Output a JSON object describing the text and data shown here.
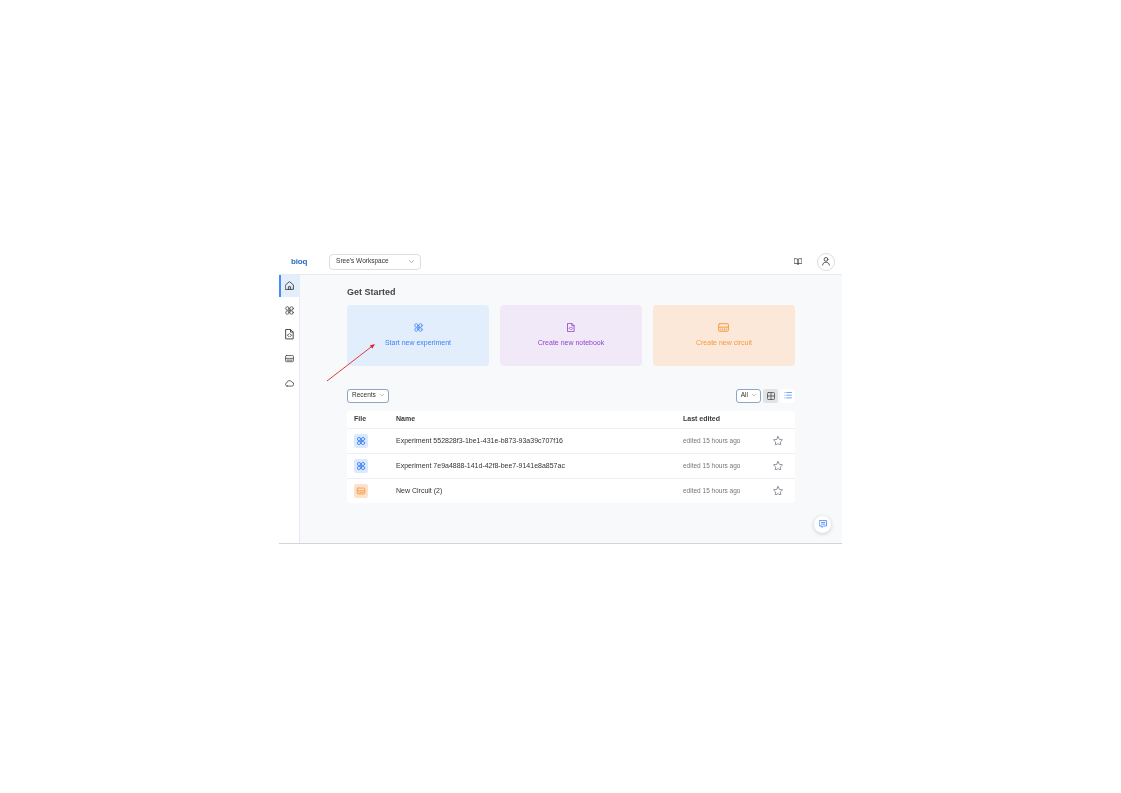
{
  "header": {
    "logo": "bioq",
    "workspace": "Sree's Workspace"
  },
  "sidebar": {
    "items": [
      {
        "kind": "home",
        "selected": true
      },
      {
        "kind": "experiment",
        "selected": false
      },
      {
        "kind": "notebook",
        "selected": false
      },
      {
        "kind": "circuit",
        "selected": false
      },
      {
        "kind": "cloud",
        "selected": false
      }
    ]
  },
  "heading": "Get Started",
  "quick_actions": [
    {
      "kind": "experiment",
      "label": "Start new experiment"
    },
    {
      "kind": "notebook",
      "label": "Create new notebook"
    },
    {
      "kind": "circuit",
      "label": "Create new circuit"
    }
  ],
  "filter": {
    "value": "Recents"
  },
  "type_filter": {
    "value": "All"
  },
  "view_toggle": [
    {
      "kind": "grid",
      "selected": true
    },
    {
      "kind": "list",
      "selected": false
    }
  ],
  "table": {
    "columns": [
      "File",
      "Name",
      "Last edited"
    ],
    "rows": [
      {
        "kind": "experiment",
        "name": "Experiment 552828f3-1be1-431e-b873-93a39c707f16",
        "last_edited": "edited 15 hours ago",
        "starred": false
      },
      {
        "kind": "experiment",
        "name": "Experiment 7e9a4888-141d-42f8-bee7-9141e8a857ac",
        "last_edited": "edited 15 hours ago",
        "starred": false
      },
      {
        "kind": "circuit",
        "name": "New Circuit (2)",
        "last_edited": "edited 15 hours ago",
        "starred": false
      }
    ]
  },
  "annotation": {
    "kind": "arrow"
  }
}
